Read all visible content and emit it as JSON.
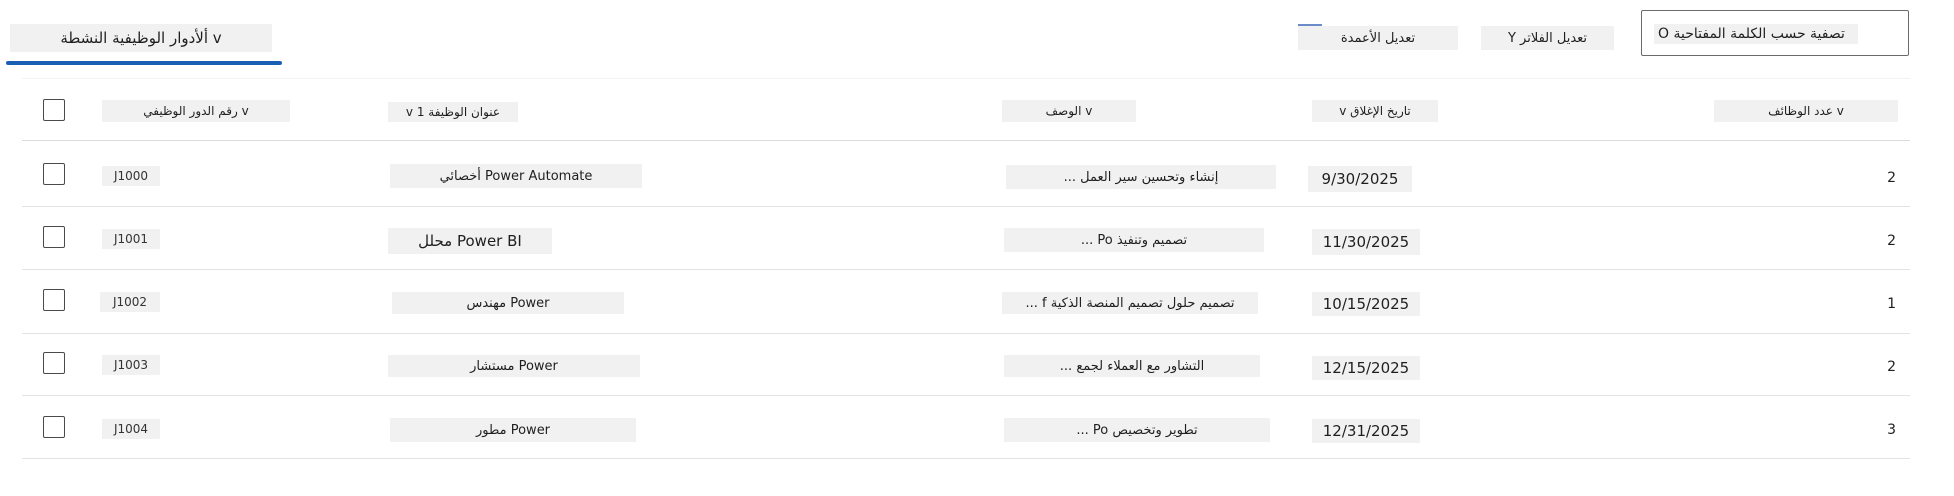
{
  "toolbar": {
    "view_selector": "ألأدوار الوظيفية النشطة ⅴ",
    "search_placeholder": "O تصفية حسب الكلمة المفتاحية",
    "edit_filters_label": "Y تعديل الفلاتر",
    "edit_columns_label": "تعديل الأعمدة"
  },
  "table": {
    "headers": {
      "job_id": "رقم الدور الوظيفي ⅴ",
      "job_title": "ⅴ 1 عنوان الوظيفة",
      "description": "الوصف ⅴ",
      "close_date": "ⅴ تاريخ الإغلاق",
      "num_positions": "عدد الوظائف ⅴ"
    },
    "rows": [
      {
        "id": "J1000",
        "title": "أخصائي Power Automate",
        "desc": "... إنشاء وتحسين سير العمل",
        "date": "9/30/2025",
        "count": "2"
      },
      {
        "id": "J1001",
        "title": "محلل Power BI",
        "desc": "... Po تصميم وتنفيذ",
        "date": "11/30/2025",
        "count": "2"
      },
      {
        "id": "J1002",
        "title": "مهندس Power",
        "desc": "... f تصميم حلول تصميم المنصة الذكية",
        "date": "10/15/2025",
        "count": "1"
      },
      {
        "id": "J1003",
        "title": "مستشار Power",
        "desc": "... التشاور مع العملاء لجمع",
        "date": "12/15/2025",
        "count": "2"
      },
      {
        "id": "J1004",
        "title": "مطور Power",
        "desc": "... Po تطوير وتخصيص",
        "date": "12/31/2025",
        "count": "3"
      }
    ]
  },
  "colors": {
    "accent": "#1a5fb4",
    "pill_bg": "#f1f1f1"
  }
}
